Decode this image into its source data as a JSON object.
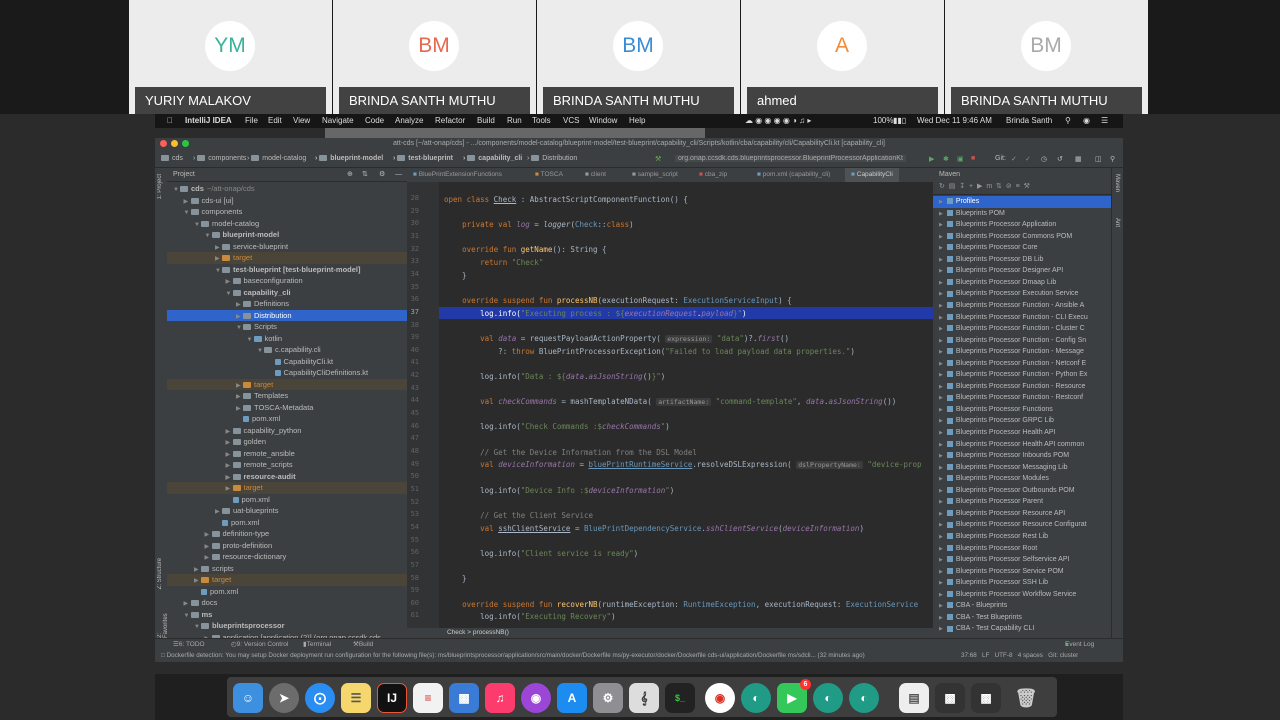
{
  "participants": [
    {
      "initials": "YM",
      "name": "YURIY MALAKOV",
      "color": "#3bb29b"
    },
    {
      "initials": "BM",
      "name": "BRINDA SANTH MUTHU",
      "color": "#e8674e"
    },
    {
      "initials": "BM",
      "name": "BRINDA SANTH MUTHU",
      "color": "#3b8bd6"
    },
    {
      "initials": "A",
      "name": "ahmed",
      "color": "#f08c3a"
    },
    {
      "initials": "BM",
      "name": "BRINDA SANTH MUTHU",
      "color": "#aaaaaa"
    }
  ],
  "menubar": {
    "app": "IntelliJ IDEA",
    "items": [
      "File",
      "Edit",
      "View",
      "Navigate",
      "Code",
      "Analyze",
      "Refactor",
      "Build",
      "Run",
      "Tools",
      "VCS",
      "Window",
      "Help"
    ],
    "battery": "100%",
    "datetime": "Wed Dec 11  9:46 AM",
    "user": "Brinda Santh"
  },
  "window": {
    "title": "att-cds [~/att-onap/cds] - .../components/model-catalog/blueprint-model/test-blueprint/capability_cli/Scripts/kotlin/cba/capability/cli/CapabilityCli.kt [capability_cli]",
    "breadcrumbs": [
      "cds",
      "components",
      "model-catalog",
      "blueprint-model",
      "test-blueprint",
      "capability_cli",
      "Distribution"
    ],
    "run_config": "org.onap.ccsdk.cds.blueprintsprocessor.BlueprintProcessorApplicationKt",
    "git_label": "Git:"
  },
  "project": {
    "header": "Project",
    "tree": [
      {
        "label": "cds",
        "suffix": "~/att-onap/cds",
        "depth": 0,
        "kind": "folder",
        "open": true,
        "bold": true
      },
      {
        "label": "cds-ui [ui]",
        "depth": 1,
        "kind": "folder",
        "open": false
      },
      {
        "label": "components",
        "depth": 1,
        "kind": "folder",
        "open": true
      },
      {
        "label": "model-catalog",
        "depth": 2,
        "kind": "folder",
        "open": true
      },
      {
        "label": "blueprint-model",
        "depth": 3,
        "kind": "folder",
        "open": true,
        "bold": true
      },
      {
        "label": "service-blueprint",
        "depth": 4,
        "kind": "folder",
        "open": false
      },
      {
        "label": "target",
        "depth": 4,
        "kind": "folder-orange",
        "excluded": true
      },
      {
        "label": "test-blueprint [test-blueprint-model]",
        "depth": 4,
        "kind": "folder",
        "open": true,
        "bold": true
      },
      {
        "label": "baseconfiguration",
        "depth": 5,
        "kind": "folder",
        "open": false
      },
      {
        "label": "capability_cli",
        "depth": 5,
        "kind": "folder",
        "open": true,
        "bold": true
      },
      {
        "label": "Definitions",
        "depth": 6,
        "kind": "folder",
        "open": false
      },
      {
        "label": "Distribution",
        "depth": 6,
        "kind": "folder",
        "open": false,
        "selected": true
      },
      {
        "label": "Scripts",
        "depth": 6,
        "kind": "folder",
        "open": true
      },
      {
        "label": "kotlin",
        "depth": 7,
        "kind": "folder-blue",
        "open": true
      },
      {
        "label": "c.capability.cli",
        "depth": 8,
        "kind": "folder",
        "open": true
      },
      {
        "label": "CapabilityCli.kt",
        "depth": 9,
        "kind": "file"
      },
      {
        "label": "CapabilityCliDefinitions.kt",
        "depth": 9,
        "kind": "file"
      },
      {
        "label": "target",
        "depth": 6,
        "kind": "folder-orange",
        "excluded": true
      },
      {
        "label": "Templates",
        "depth": 6,
        "kind": "folder",
        "open": false
      },
      {
        "label": "TOSCA-Metadata",
        "depth": 6,
        "kind": "folder",
        "open": false
      },
      {
        "label": "pom.xml",
        "depth": 6,
        "kind": "file"
      },
      {
        "label": "capability_python",
        "depth": 5,
        "kind": "folder",
        "open": false
      },
      {
        "label": "golden",
        "depth": 5,
        "kind": "folder",
        "open": false
      },
      {
        "label": "remote_ansible",
        "depth": 5,
        "kind": "folder",
        "open": false
      },
      {
        "label": "remote_scripts",
        "depth": 5,
        "kind": "folder",
        "open": false
      },
      {
        "label": "resource-audit",
        "depth": 5,
        "kind": "folder",
        "open": false,
        "bold": true
      },
      {
        "label": "target",
        "depth": 5,
        "kind": "folder-orange",
        "excluded": true
      },
      {
        "label": "pom.xml",
        "depth": 5,
        "kind": "file"
      },
      {
        "label": "uat-blueprints",
        "depth": 4,
        "kind": "folder",
        "open": false
      },
      {
        "label": "pom.xml",
        "depth": 4,
        "kind": "file"
      },
      {
        "label": "definition-type",
        "depth": 3,
        "kind": "folder",
        "open": false
      },
      {
        "label": "proto-definition",
        "depth": 3,
        "kind": "folder",
        "open": false
      },
      {
        "label": "resource-dictionary",
        "depth": 3,
        "kind": "folder",
        "open": false
      },
      {
        "label": "scripts",
        "depth": 2,
        "kind": "folder",
        "open": false
      },
      {
        "label": "target",
        "depth": 2,
        "kind": "folder-orange",
        "excluded": true
      },
      {
        "label": "pom.xml",
        "depth": 2,
        "kind": "file"
      },
      {
        "label": "docs",
        "depth": 1,
        "kind": "folder",
        "open": false
      },
      {
        "label": "ms",
        "depth": 1,
        "kind": "folder",
        "open": true,
        "bold": true
      },
      {
        "label": "blueprintsprocessor",
        "depth": 2,
        "kind": "folder",
        "open": true,
        "bold": true
      },
      {
        "label": "application [application (2)] (org.onap.ccsdk.cds",
        "depth": 3,
        "kind": "folder",
        "open": false
      }
    ]
  },
  "editor": {
    "tabs": [
      "BluePrintExtensionFunctions",
      "TOSCA",
      "client",
      "sample_script",
      "cba_zip",
      "pom.xml (capability_cli)",
      "CapabilityCli"
    ],
    "active_tab": "CapabilityCli",
    "line_numbers": [
      "28",
      "29",
      "30",
      "31",
      "32",
      "33",
      "34",
      "35",
      "36",
      "37",
      "38",
      "39",
      "40",
      "41",
      "42",
      "43",
      "44",
      "45",
      "46",
      "47",
      "48",
      "49",
      "50",
      "51",
      "52",
      "53",
      "54",
      "55",
      "56",
      "57",
      "58",
      "59",
      "60",
      "61"
    ],
    "highlighted_line": "37",
    "bottom_breadcrumb": "Check  >  processNB()"
  },
  "maven": {
    "header": "Maven",
    "items": [
      "Profiles",
      "Blueprints POM",
      "Blueprints Processor Application",
      "Blueprints Processor Commons POM",
      "Blueprints Processor Core",
      "Blueprints Processor DB Lib",
      "Blueprints Processor Designer API",
      "Blueprints Processor Dmaap Lib",
      "Blueprints Processor Execution Service",
      "Blueprints Processor Function - Ansible A",
      "Blueprints Processor Function - CLI Execu",
      "Blueprints Processor Function - Cluster C",
      "Blueprints Processor Function - Config Sn",
      "Blueprints Processor Function - Message",
      "Blueprints Processor Function - Netconf E",
      "Blueprints Processor Function - Python Ex",
      "Blueprints Processor Function - Resource",
      "Blueprints Processor Function - Restconf",
      "Blueprints Processor Functions",
      "Blueprints Processor GRPC Lib",
      "Blueprints Processor Health API",
      "Blueprints Processor Health API common",
      "Blueprints Processor Inbounds POM",
      "Blueprints Processor Messaging Lib",
      "Blueprints Processor Modules",
      "Blueprints Processor Outbounds POM",
      "Blueprints Processor Parent",
      "Blueprints Processor Resource API",
      "Blueprints Processor Resource Configurat",
      "Blueprints Processor Rest Lib",
      "Blueprints Processor Root",
      "Blueprints Processor Selfservice API",
      "Blueprints Processor Service POM",
      "Blueprints Processor SSH Lib",
      "Blueprints Processor Workflow Service",
      "CBA - Blueprints",
      "CBA - Test Blueprints",
      "CBA - Test Capability CLI"
    ]
  },
  "toolwindows": {
    "todo": "6: TODO",
    "vcs": "9: Version Control",
    "terminal": "Terminal",
    "build": "Build",
    "event_log": "Event Log"
  },
  "status": {
    "message": "Dockerfile detection: You may setup Docker deployment run configuration for the following file(s): ms/blueprintsprocessor/application/src/main/docker/Dockerfile ms/py-executor/docker/Dockerfile cds-ui/application/Dockerfile ms/sdcli... (32 minutes ago)",
    "position": "37:68",
    "line_sep": "LF",
    "encoding": "UTF-8",
    "indent": "4 spaces",
    "git": "Git: cluster"
  },
  "dock": {
    "apps": [
      "finder",
      "launchpad",
      "safari",
      "notes",
      "intellij",
      "reminders",
      "keynote",
      "music",
      "podcasts",
      "app-store",
      "system-preferences",
      "script-editor",
      "terminal",
      "chrome",
      "webex",
      "facetime",
      "webex-meetings",
      "webex-teams",
      "preview",
      "screenshot",
      "screenshot-2",
      "trash"
    ],
    "facetime_badge": "6"
  }
}
